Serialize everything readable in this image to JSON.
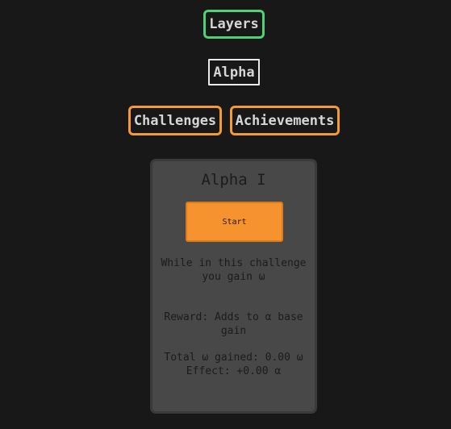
{
  "nav": {
    "layers_label": "Layers"
  },
  "tabs": {
    "active_layer_label": "Alpha",
    "subtabs": [
      "Challenges",
      "Achievements"
    ]
  },
  "challenge": {
    "title": "Alpha I",
    "start_label": "Start",
    "description": "While in this challenge you gain ω",
    "reward": "Reward: Adds to α base gain",
    "total_gained": "Total ω gained: 0.00 ω",
    "effect": "Effect: +0.00 α"
  },
  "colors": {
    "background": "#181818",
    "layers_border": "#4fd17a",
    "subtab_border": "#f39a32",
    "card_bg": "#484848",
    "start_button": "#f6932f"
  }
}
